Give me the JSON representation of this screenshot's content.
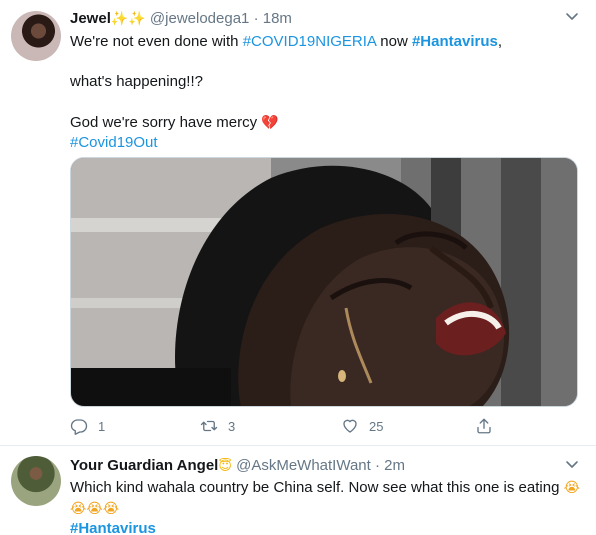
{
  "tweet1": {
    "display_name": "Jewel",
    "name_emoji": "✨✨",
    "handle": "@jewelodega1",
    "separator": "·",
    "time": "18m",
    "text_line1_start": "We're not even done with ",
    "hashtag_covid_nigeria": "#COVID19NIGERIA",
    "text_line1_mid": " now ",
    "hashtag_hantavirus": "#Hantavirus",
    "text_line1_end": ",",
    "text_line2": "what's happening!!?",
    "text_line3": "God we're sorry have mercy",
    "broken_heart": "💔",
    "hashtag_covid_out": "#Covid19Out",
    "replies": "1",
    "retweets": "3",
    "likes": "25"
  },
  "tweet2": {
    "display_name": "Your Guardian Angel",
    "name_emoji": "😇",
    "handle": "@AskMeWhatIWant",
    "separator": "·",
    "time": "2m",
    "text_line1": "Which kind wahala country be China self. Now see what this one is eating",
    "emoji_sob_inline": "😭",
    "emoji_sob_row": "😭😭😭",
    "hashtag_hantavirus": "#Hantavirus"
  },
  "icons": {
    "chevron": "chevron-down-icon",
    "reply": "reply-icon",
    "retweet": "retweet-icon",
    "like": "heart-icon",
    "share": "share-icon"
  },
  "colors": {
    "link": "#1b95e0",
    "secondary_text": "#657786",
    "divider": "#e6ecf0"
  }
}
